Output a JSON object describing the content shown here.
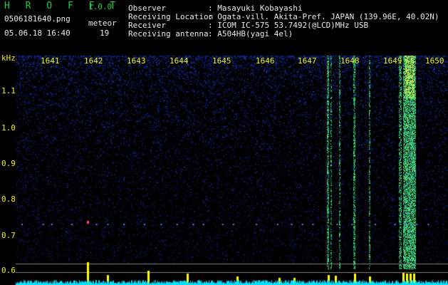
{
  "header": {
    "app_title": "H R O F F T",
    "app_version": "1.0.0",
    "filename": "0506181640.png",
    "datetime": "05.06.18 16:40",
    "meteor_label": "meteor",
    "meteor_count": "19",
    "observer_label": "Observer",
    "observer_value": ": Masayuki Kobayashi",
    "location_label": "Receiving Location",
    "location_value": ": Ogata-vill. Akita-Pref. JAPAN (139.96E, 40.02N)",
    "receiver_label": "Receiver",
    "receiver_value": ": ICOM IC-575 53.7492(@LCD)MHz USB",
    "antenna_label": "Receiving antenna",
    "antenna_value": ": A504HB(yagi 4el)"
  },
  "plot": {
    "y_unit": "kHz",
    "time_ticks": [
      "1641",
      "1642",
      "1643",
      "1644",
      "1645",
      "1646",
      "1647",
      "1648",
      "1649",
      "1650"
    ],
    "freq_ticks": [
      "1.1",
      "1.0",
      "0.9",
      "0.8",
      "0.7",
      "0.6"
    ],
    "colors": {
      "background": "#000000",
      "tick_text": "#f0f000",
      "noise": "#1a2a9a",
      "echo": "#20e060",
      "meteor_bar": "#ffff00",
      "baseline": "#00ffff"
    }
  }
}
